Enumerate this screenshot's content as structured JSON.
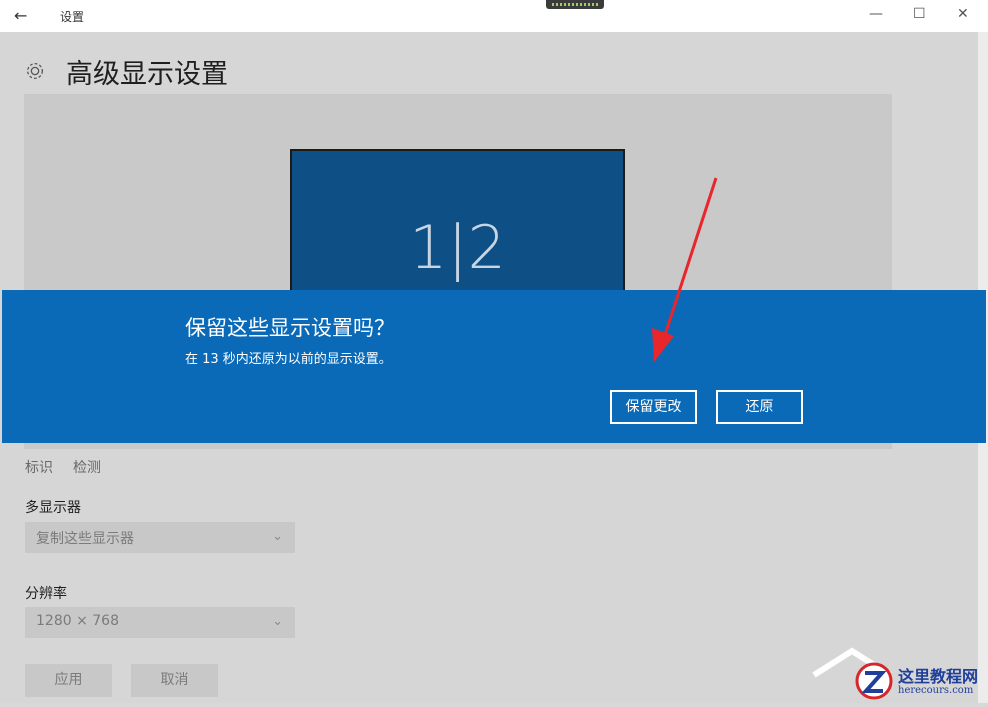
{
  "window": {
    "title": "设置",
    "back_icon": "←",
    "minimize_icon": "—",
    "maximize_icon": "☐",
    "close_icon": "✕"
  },
  "page": {
    "title": "高级显示设置",
    "monitor_label": "1|2"
  },
  "dialog": {
    "heading": "保留这些显示设置吗？",
    "message": "在 13 秒内还原为以前的显示设置。",
    "keep_button": "保留更改",
    "revert_button": "还原"
  },
  "links": {
    "identify": "标识",
    "detect": "检测"
  },
  "multi_display": {
    "label": "多显示器",
    "selected": "复制这些显示器"
  },
  "resolution": {
    "label": "分辨率",
    "selected": "1280 × 768"
  },
  "actions": {
    "apply": "应用",
    "cancel": "取消"
  },
  "watermark": {
    "name": "这里教程网",
    "url": "herecours.com"
  },
  "colors": {
    "dialog_bg": "#0a6ab8",
    "monitor_bg": "#0e4f86",
    "arrow": "#e8262b"
  }
}
